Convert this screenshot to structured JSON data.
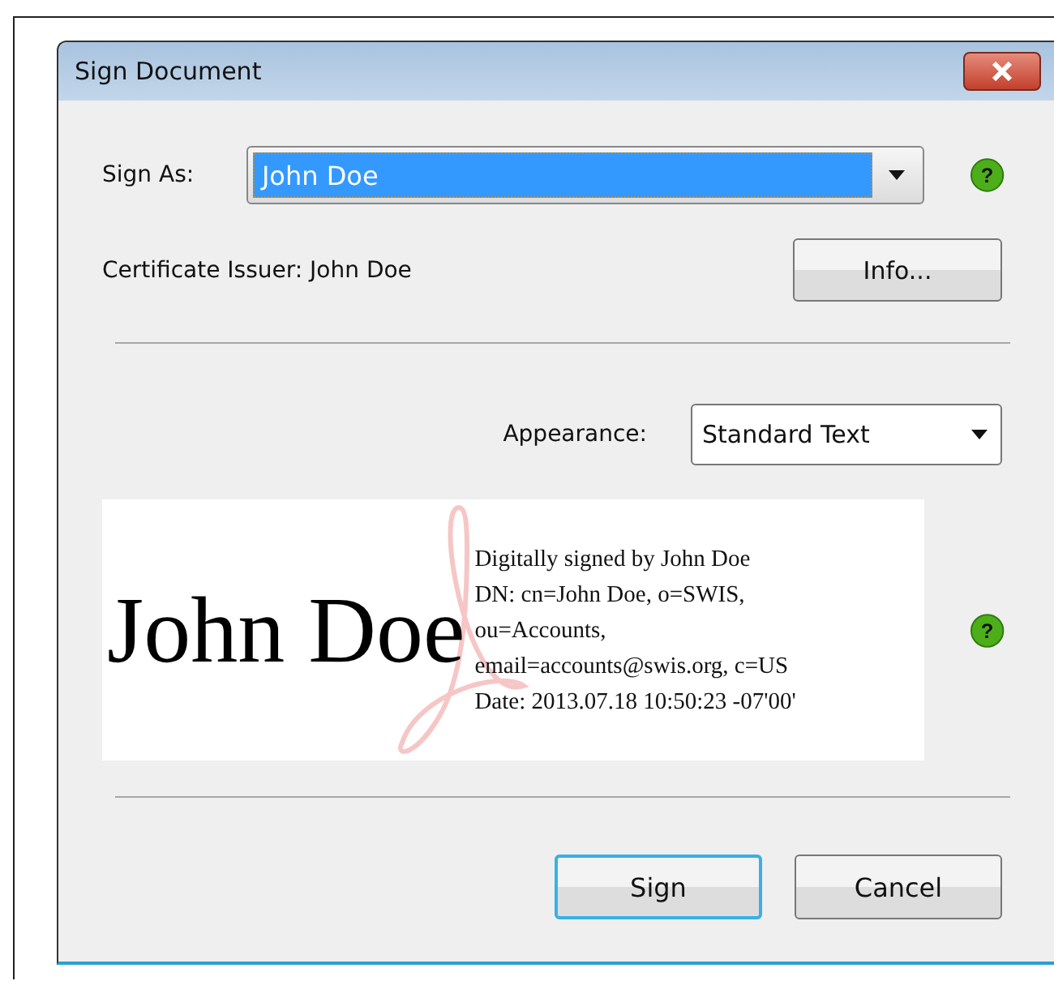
{
  "window": {
    "title": "Sign Document"
  },
  "sign_as": {
    "label": "Sign As:",
    "value": "John Doe",
    "help": "?"
  },
  "certificate_issuer": "Certificate Issuer: John Doe",
  "info_button": "Info...",
  "appearance": {
    "label": "Appearance:",
    "value": "Standard Text"
  },
  "preview": {
    "help": "?",
    "name": "John Doe",
    "details": [
      "Digitally signed by John Doe",
      "DN: cn=John Doe, o=SWIS,",
      "ou=Accounts,",
      "email=accounts@swis.org, c=US",
      "Date: 2013.07.18 10:50:23 -07'00'"
    ]
  },
  "buttons": [
    {
      "label": "Sign",
      "default": true
    },
    {
      "label": "Cancel",
      "default": false
    }
  ]
}
